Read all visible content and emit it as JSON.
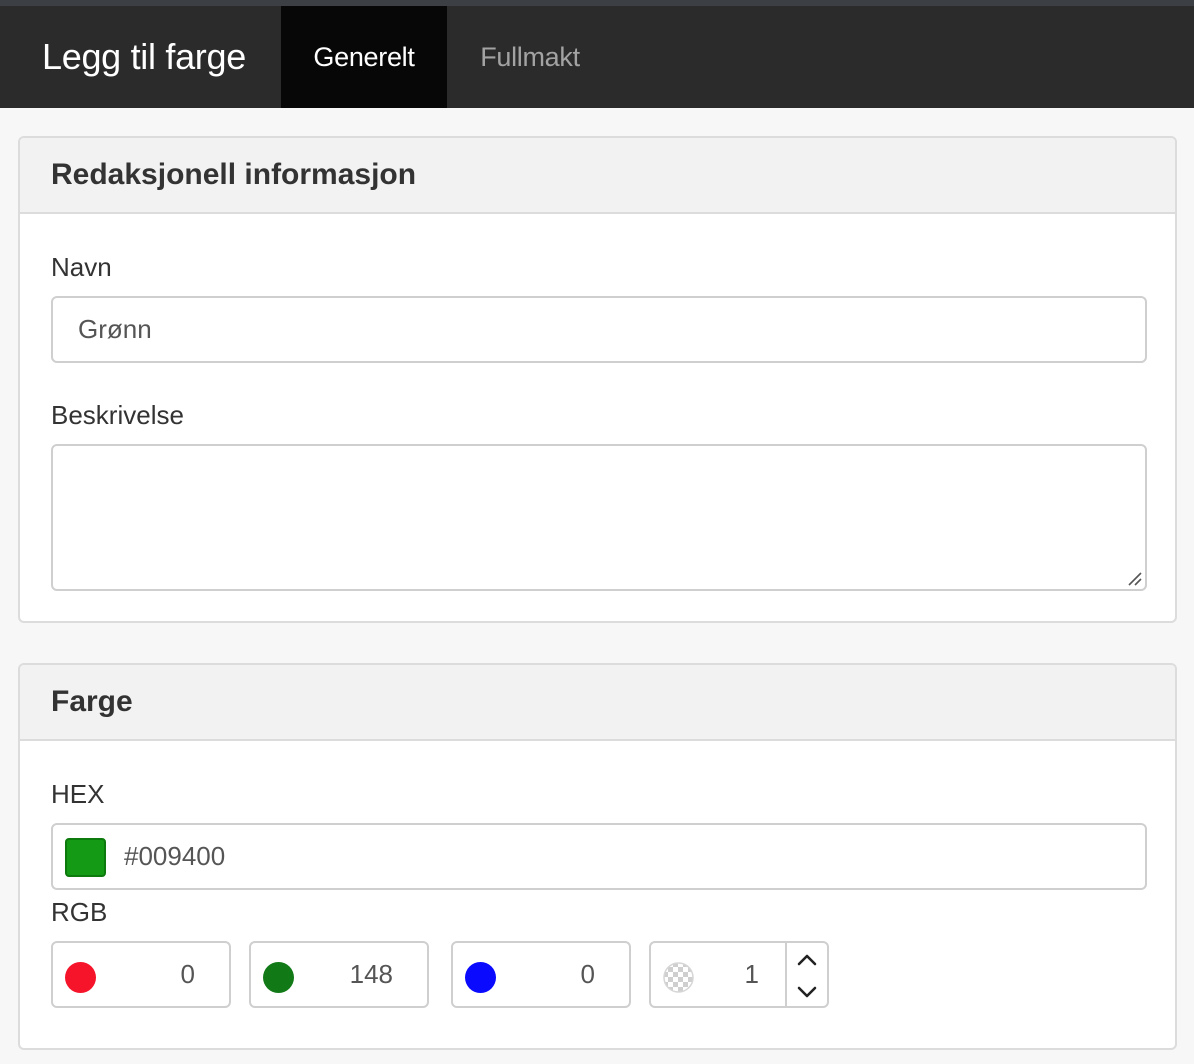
{
  "header": {
    "title": "Legg til farge",
    "tabs": [
      {
        "label": "Generelt",
        "active": true
      },
      {
        "label": "Fullmakt",
        "active": false
      }
    ]
  },
  "editorial": {
    "heading": "Redaksjonell informasjon",
    "name_label": "Navn",
    "name_value": "Grønn",
    "description_label": "Beskrivelse",
    "description_value": ""
  },
  "color": {
    "heading": "Farge",
    "hex_label": "HEX",
    "hex_value": "#009400",
    "swatch_color": "#159a15",
    "rgb_label": "RGB",
    "red": "0",
    "green": "148",
    "blue": "0",
    "alpha": "1",
    "red_dot_color": "#f5142a",
    "green_dot_color": "#117a17",
    "blue_dot_color": "#0a0aff"
  }
}
